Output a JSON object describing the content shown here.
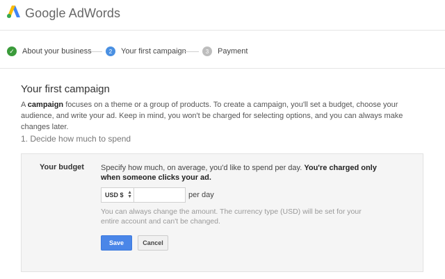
{
  "header": {
    "brand": "Google AdWords",
    "logo_icon": "adwords-logo-icon"
  },
  "steps": [
    {
      "label": "About your business",
      "state": "done",
      "marker": "✓",
      "icon": "check-icon"
    },
    {
      "label": "Your first campaign",
      "state": "active",
      "marker": "2"
    },
    {
      "label": "Payment",
      "state": "todo",
      "marker": "3"
    }
  ],
  "main": {
    "title": "Your first campaign",
    "intro_lead": "A ",
    "intro_bold": "campaign",
    "intro_rest": " focuses on a theme or a group of products. To create a campaign, you'll set a budget, choose your audience, and write your ad. Keep in mind, you won't be charged for selecting options, and you can always make changes later.",
    "section_title": "1. Decide how much to spend"
  },
  "budget": {
    "label": "Your budget",
    "desc_plain": "Specify how much, on average, you'd like to spend per day. ",
    "desc_bold": "You're charged only when someone clicks your ad.",
    "currency_value": "USD $",
    "amount_value": "",
    "per_day_label": "per day",
    "hint": "You can always change the amount. The currency type (USD) will be set for your entire account and can't be changed.",
    "save_label": "Save",
    "cancel_label": "Cancel"
  },
  "colors": {
    "accent": "#4a86e8",
    "done": "#3a9b3a",
    "inactive": "#bdbdbd"
  }
}
